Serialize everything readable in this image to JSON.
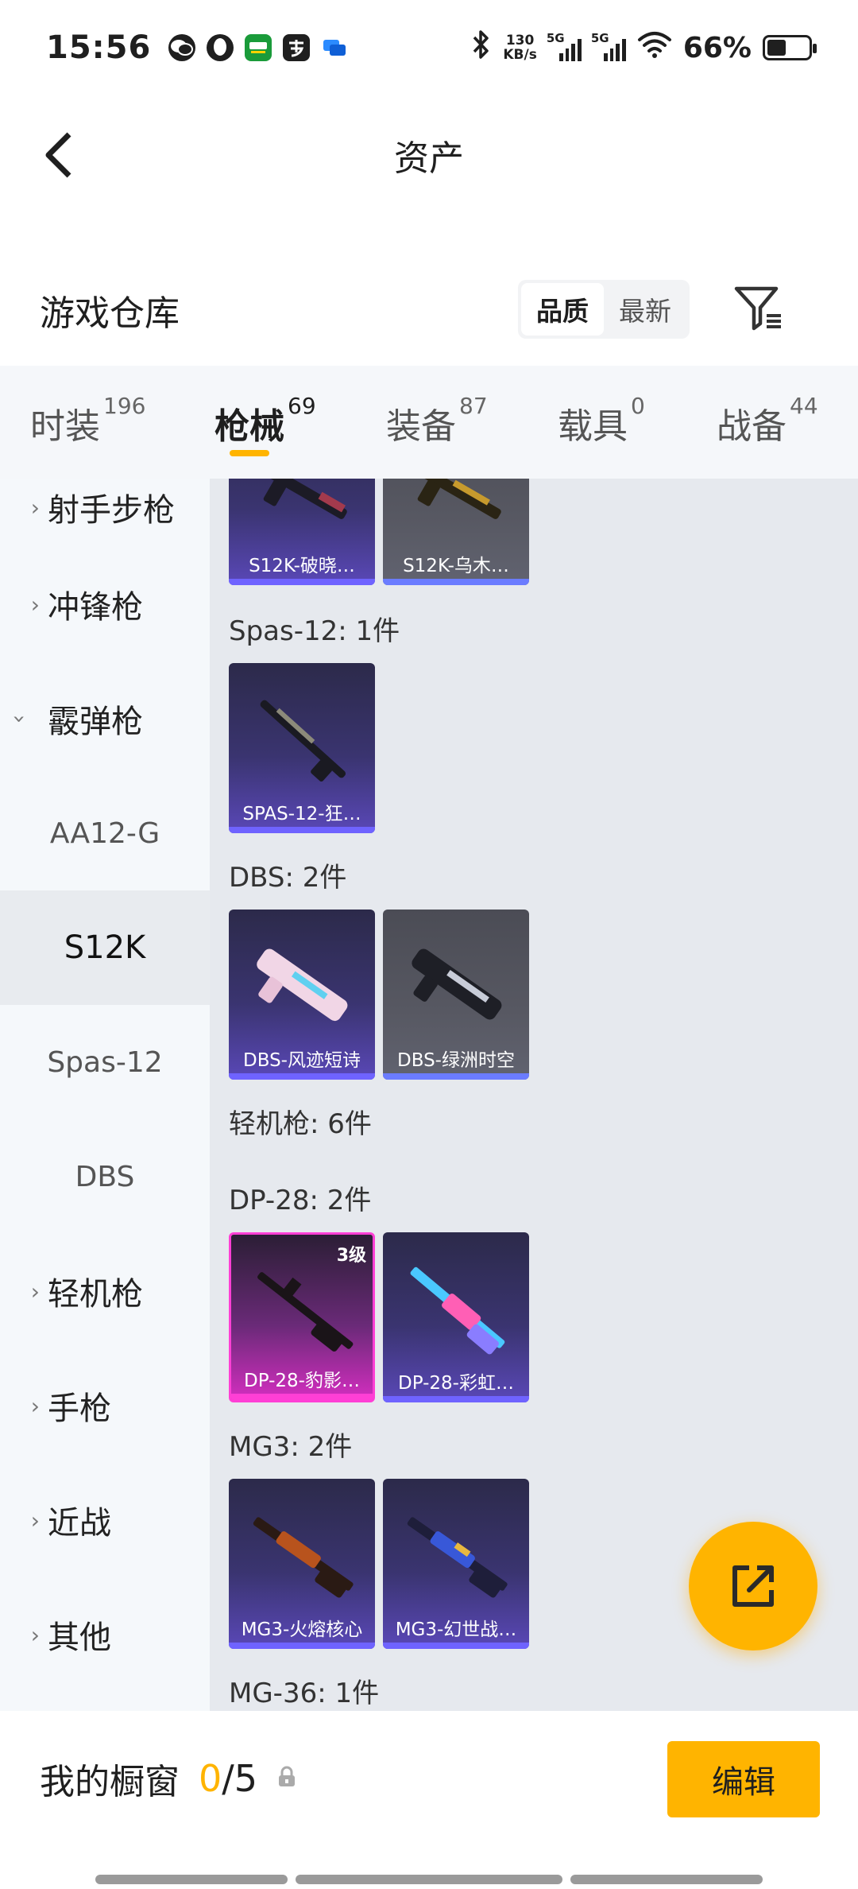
{
  "status_bar": {
    "time": "15:56",
    "speed_value": "130",
    "speed_unit": "KB/s",
    "net1": "5G",
    "net2": "5G",
    "battery": "66%",
    "apps": [
      "wechat-icon",
      "qq-icon",
      "guazi-icon",
      "alipay-icon",
      "message-icon"
    ]
  },
  "header": {
    "title": "资产"
  },
  "section": {
    "title": "游戏仓库",
    "sort_options": [
      "品质",
      "最新"
    ]
  },
  "tabs": [
    {
      "label": "时装",
      "count": "196"
    },
    {
      "label": "枪械",
      "count": "69"
    },
    {
      "label": "装备",
      "count": "87"
    },
    {
      "label": "载具",
      "count": "0"
    },
    {
      "label": "战备",
      "count": "44"
    }
  ],
  "sidebar": {
    "items": [
      {
        "label": "射手步枪"
      },
      {
        "label": "冲锋枪"
      },
      {
        "label": "霰弹枪"
      },
      {
        "label": "AA12-G"
      },
      {
        "label": "S12K"
      },
      {
        "label": "Spas-12"
      },
      {
        "label": "DBS"
      },
      {
        "label": "轻机枪"
      },
      {
        "label": "手枪"
      },
      {
        "label": "近战"
      },
      {
        "label": "其他"
      }
    ]
  },
  "content": {
    "groups": [
      {
        "label": "Spas-12: 1件"
      },
      {
        "label": "DBS: 2件"
      },
      {
        "label": "轻机枪: 6件"
      },
      {
        "label": "DP-28: 2件"
      },
      {
        "label": "MG3: 2件"
      },
      {
        "label": "MG-36: 1件"
      }
    ],
    "cards": [
      {
        "name": "S12K-破晓…",
        "rarity": "blue"
      },
      {
        "name": "S12K-乌木…",
        "rarity": "gray"
      },
      {
        "name": "SPAS-12-狂…",
        "rarity": "blue"
      },
      {
        "name": "DBS-风迹短诗",
        "rarity": "blue"
      },
      {
        "name": "DBS-绿洲时空",
        "rarity": "gray"
      },
      {
        "name": "DP-28-豹影…",
        "rarity": "pink",
        "level": "3级"
      },
      {
        "name": "DP-28-彩虹…",
        "rarity": "blue"
      },
      {
        "name": "MG3-火熔核心",
        "rarity": "blue"
      },
      {
        "name": "MG3-幻世战…",
        "rarity": "blue"
      }
    ]
  },
  "bottom": {
    "showcase_title": "我的橱窗",
    "current": "0",
    "separator": "/",
    "max": "5",
    "edit_label": "编辑"
  },
  "colors": {
    "accent": "#ffb400",
    "rarity_blue": "#5a48b8",
    "rarity_pink": "#ff3fd5",
    "rarity_gray": "#575862"
  }
}
